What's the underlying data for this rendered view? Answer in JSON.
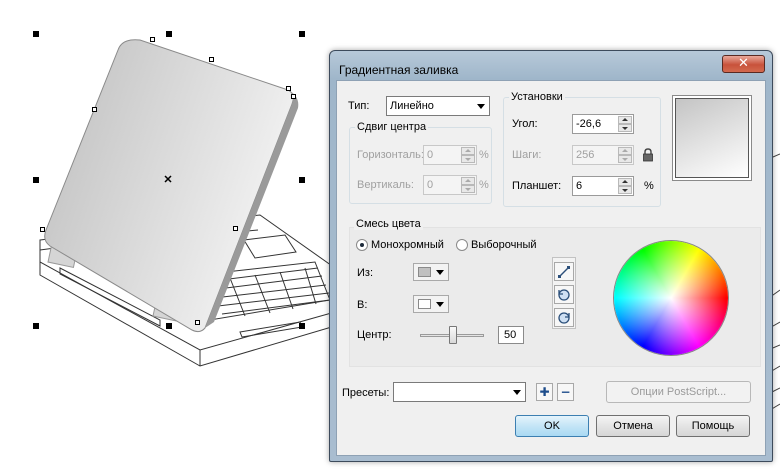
{
  "dialog": {
    "title": "Градиентная заливка",
    "close_glyph": "✕",
    "type_label": "Тип:",
    "type_value": "Линейно",
    "center_offset": {
      "title": "Сдвиг центра",
      "horizontal_label": "Горизонталь:",
      "horizontal_value": "0",
      "vertical_label": "Вертикаль:",
      "vertical_value": "0",
      "unit": "%"
    },
    "settings": {
      "title": "Установки",
      "angle_label": "Угол:",
      "angle_value": "-26,6",
      "steps_label": "Шаги:",
      "steps_value": "256",
      "lock_icon": "lock-icon",
      "pad_label": "Планшет:",
      "pad_value": "6",
      "pad_unit": "%"
    },
    "color_blend": {
      "title": "Смесь цвета",
      "mono_label": "Монохромный",
      "custom_label": "Выборочный",
      "selected_mode": "Монохромный",
      "from_label": "Из:",
      "from_color": "#c0c0c0",
      "to_label": "В:",
      "to_color": "#ffffff",
      "center_label": "Центр:",
      "center_value": "50",
      "direct_icon": "diagonal-line-icon",
      "ccw_icon": "counterclockwise-icon",
      "cw_icon": "clockwise-icon"
    },
    "presets": {
      "label": "Пресеты:",
      "value": "",
      "add_glyph": "✚",
      "remove_glyph": "−",
      "postscript_label": "Опции PostScript..."
    },
    "buttons": {
      "ok": "OK",
      "cancel": "Отмена",
      "help": "Помощь"
    }
  }
}
